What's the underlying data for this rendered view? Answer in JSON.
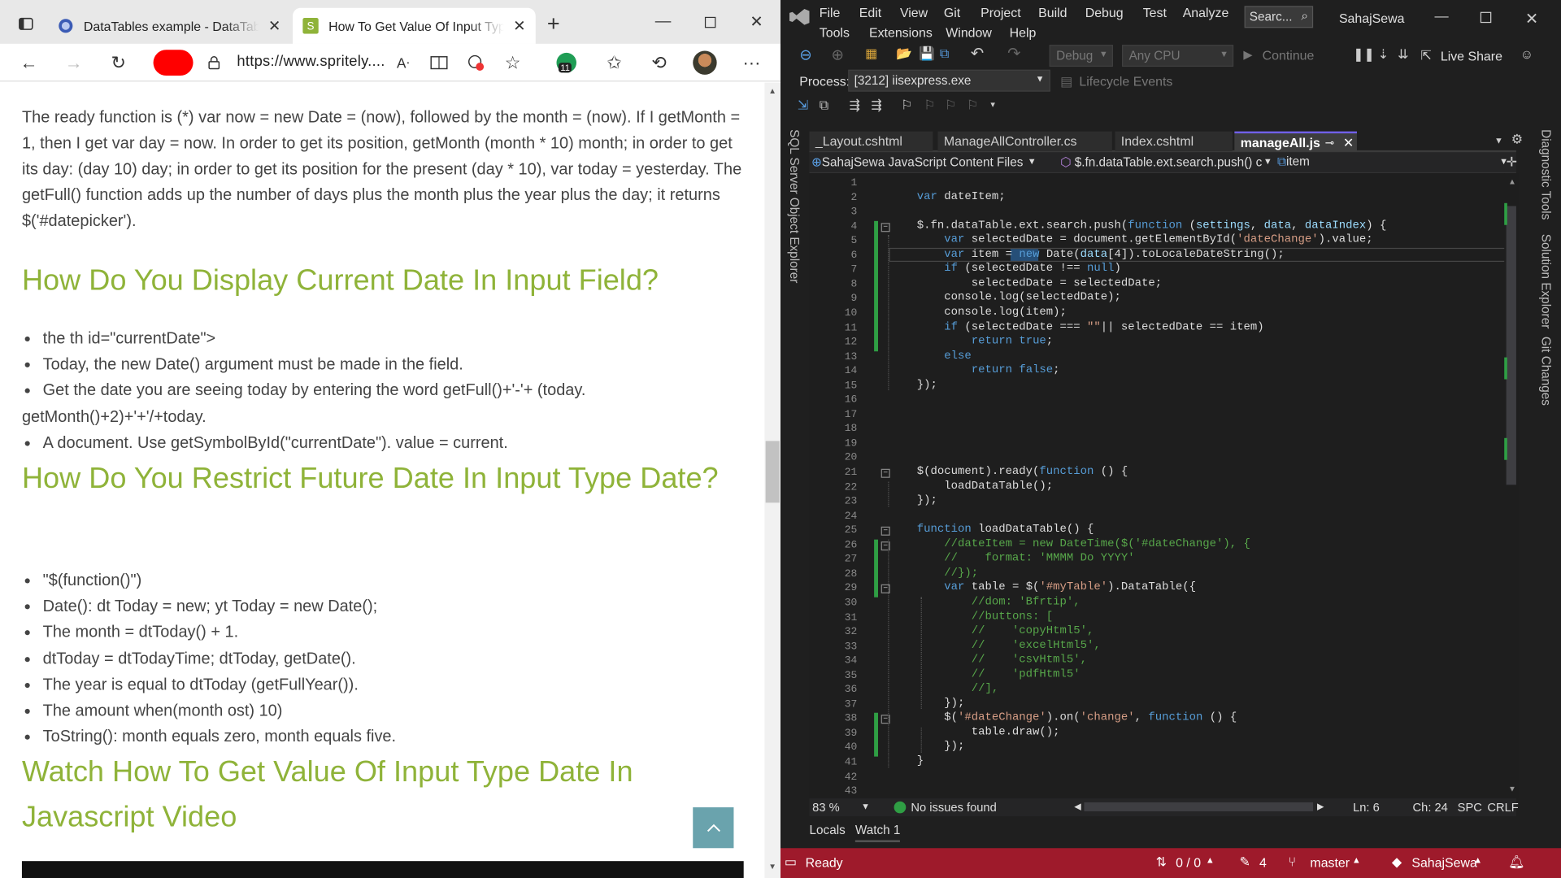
{
  "browser": {
    "tabs": [
      {
        "title": "DataTables example - DataTables"
      },
      {
        "title": "How To Get Value Of Input Type Date"
      }
    ],
    "url": "https://www.spritely....",
    "badge_count": "11",
    "article": {
      "intro": "The ready function is (*) var now = new Date = (now), followed by the month = (now). If I getMonth = 1, then I get var day = now. In order to get its position, getMonth (month * 10) month; in order to get its day: (day 10) day; in order to get its position for the present (day * 10), var today = yesterday. The getFull() function adds up the number of days plus the month plus the year plus the day; it returns $('#datepicker').",
      "h1": "How Do You Display Current Date In Input Field?",
      "list1": [
        "the th id=\"currentDate\">",
        "Today, the new Date() argument must be made in the field.",
        "Get the date you are seeing today by entering the word getFull()+'-'+ (today.",
        "getMonth()+2)+'+'/+today.",
        "A document. Use getSymbolById(\"currentDate\"). value = current."
      ],
      "h2": "How Do You Restrict Future Date In Input Type Date?",
      "list2": [
        "\"$(function()\")",
        "Date(): dt Today = new; yt Today = new Date();",
        "The month = dtToday() + 1.",
        "dtToday = dtTodayTime; dtToday, getDate().",
        "The year is equal to dtToday (getFullYear()).",
        "The amount when(month ost) 10)",
        "ToString(): month equals zero, month equals five."
      ],
      "h3": "Watch How To Get Value Of Input Type Date In Javascript Video"
    }
  },
  "vs": {
    "menu_row1": [
      "File",
      "Edit",
      "View",
      "Git",
      "Project",
      "Build",
      "Debug",
      "Test",
      "Analyze"
    ],
    "menu_row2": [
      "Tools",
      "Extensions",
      "Window",
      "Help"
    ],
    "search_placeholder": "Searc...",
    "solution_name": "SahajSewa",
    "config": "Debug",
    "platform": "Any CPU",
    "continue_label": "Continue",
    "live_share": "Live Share",
    "process_label": "Process:",
    "process_value": "[3212] iisexpress.exe",
    "lifecycle": "Lifecycle Events",
    "doc_tabs": [
      "_Layout.cshtml",
      "ManageAllController.cs",
      "Index.cshtml",
      "manageAll.js"
    ],
    "nav_project": "SahajSewa JavaScript Content Files",
    "nav_scope": "$.fn.dataTable.ext.search.push() c",
    "nav_member": "item",
    "side_left": "SQL Server Object Explorer",
    "side_right": [
      "Diagnostic Tools",
      "Solution Explorer",
      "Git Changes"
    ],
    "zoom": "83 %",
    "issues": "No issues found",
    "line_info": "Ln: 6",
    "col_info": "Ch: 24",
    "spc": "SPC",
    "crlf": "CRLF",
    "bottom_tabs": [
      "Locals",
      "Watch 1"
    ],
    "status": {
      "ready": "Ready",
      "updown": "0 / 0",
      "edits": "4",
      "branch": "master",
      "repo": "SahajSewa"
    },
    "code_lines": [
      "",
      "var dateItem;",
      "",
      "$.fn.dataTable.ext.search.push(function (settings, data, dataIndex) {",
      "    var selectedDate = document.getElementById('dateChange').value;",
      "    var item = new Date(data[4]).toLocaleDateString();",
      "    if (selectedDate !== null)",
      "        selectedDate = selectedDate;",
      "    console.log(selectedDate);",
      "    console.log(item);",
      "    if (selectedDate === \"\"|| selectedDate == item)",
      "        return true;",
      "    else",
      "        return false;",
      "});",
      "",
      "",
      "",
      "",
      "",
      "$(document).ready(function () {",
      "    loadDataTable();",
      "});",
      "",
      "function loadDataTable() {",
      "    //dateItem = new DateTime($('#dateChange'), {",
      "    //    format: 'MMMM Do YYYY'",
      "    //});",
      "    var table = $('#myTable').DataTable({",
      "        //dom: 'Bfrtip',",
      "        //buttons: [",
      "        //    'copyHtml5',",
      "        //    'excelHtml5',",
      "        //    'csvHtml5',",
      "        //    'pdfHtml5'",
      "        //],",
      "    });",
      "    $('#dateChange').on('change', function () {",
      "        table.draw();",
      "    });",
      "}",
      "",
      ""
    ]
  }
}
